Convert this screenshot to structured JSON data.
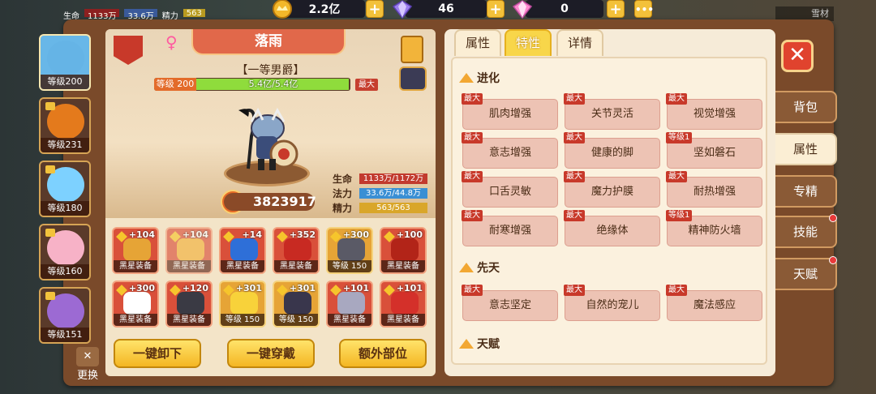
{
  "top": {
    "gold": "2.2亿",
    "gems": "46",
    "crystals": "0",
    "stats_hp_label": "生命",
    "stats_hp_value": "1133万",
    "stats_atk_value": "33.6万",
    "stats_energy_label": "精力",
    "stats_energy_value": "563",
    "right_label": "雪材"
  },
  "heroes": [
    {
      "level": "等级200",
      "color": "#65b4e6",
      "selected": true
    },
    {
      "level": "等级231",
      "color": "#e47a1c",
      "selected": false
    },
    {
      "level": "等级180",
      "color": "#7dd1ff",
      "selected": false
    },
    {
      "level": "等级160",
      "color": "#f7b2c7",
      "selected": false
    },
    {
      "level": "等级151",
      "color": "#9c6ad3",
      "selected": false
    }
  ],
  "hero": {
    "name": "落雨",
    "title": "【一等男爵】",
    "level_label": "等级 200",
    "exp_text": "5.4亿/5.4亿",
    "exp_fraction": 1.0,
    "max_badge": "最大",
    "power": "3823917",
    "hp_label": "生命",
    "hp_value": "1133万/1172万",
    "mp_label": "法力",
    "mp_value": "33.6万/44.8万",
    "en_label": "精力",
    "en_value": "563/563"
  },
  "equipment": [
    {
      "plus": "+104",
      "caption": "黑星装备",
      "style": "red",
      "art": "#e6a436"
    },
    {
      "plus": "+104",
      "caption": "黑星装备",
      "style": "red",
      "art": "#f2b13a",
      "dim": true
    },
    {
      "plus": "+14",
      "caption": "黑星装备",
      "style": "red",
      "art": "#2e6fd8"
    },
    {
      "plus": "+352",
      "caption": "黑星装备",
      "style": "red",
      "art": "#c82a22"
    },
    {
      "plus": "+300",
      "caption": "等级 150",
      "style": "gold",
      "art": "#5a5a66"
    },
    {
      "plus": "+100",
      "caption": "黑星装备",
      "style": "red",
      "art": "#b22418"
    },
    {
      "plus": "+300",
      "caption": "黑星装备",
      "style": "red",
      "art": "#ffffff"
    },
    {
      "plus": "+120",
      "caption": "黑星装备",
      "style": "red",
      "art": "#3a3a44"
    },
    {
      "plus": "+301",
      "caption": "等级 150",
      "style": "gold",
      "art": "#f8d23a"
    },
    {
      "plus": "+301",
      "caption": "等级 150",
      "style": "gold",
      "art": "#39364c"
    },
    {
      "plus": "+101",
      "caption": "黑星装备",
      "style": "red",
      "art": "#a8a8c0"
    },
    {
      "plus": "+101",
      "caption": "黑星装备",
      "style": "red",
      "art": "#d4302a"
    }
  ],
  "buttons": {
    "unequip": "一键卸下",
    "equip": "一键穿戴",
    "extra": "额外部位"
  },
  "swap_label": "更换",
  "tabs": {
    "attr": "属性",
    "trait": "特性",
    "detail": "详情"
  },
  "sections": {
    "evolve": "进化",
    "innate": "先天",
    "talent": "天赋"
  },
  "evolve_traits": [
    {
      "tag": "最大",
      "label": "肌肉增强"
    },
    {
      "tag": "最大",
      "label": "关节灵活"
    },
    {
      "tag": "最大",
      "label": "视觉增强"
    },
    {
      "tag": "最大",
      "label": "意志增强"
    },
    {
      "tag": "最大",
      "label": "健康的脚"
    },
    {
      "tag": "等级1",
      "label": "坚如磐石"
    },
    {
      "tag": "最大",
      "label": "口舌灵敏"
    },
    {
      "tag": "最大",
      "label": "魔力护膜"
    },
    {
      "tag": "最大",
      "label": "耐热增强"
    },
    {
      "tag": "最大",
      "label": "耐寒增强"
    },
    {
      "tag": "最大",
      "label": "绝缘体"
    },
    {
      "tag": "等级1",
      "label": "精神防火墙"
    }
  ],
  "innate_traits": [
    {
      "tag": "最大",
      "label": "意志坚定"
    },
    {
      "tag": "最大",
      "label": "自然的宠儿"
    },
    {
      "tag": "最大",
      "label": "魔法感应"
    }
  ],
  "side_tabs": [
    {
      "label": "背包",
      "active": false,
      "dot": false
    },
    {
      "label": "属性",
      "active": true,
      "dot": false
    },
    {
      "label": "专精",
      "active": false,
      "dot": false
    },
    {
      "label": "技能",
      "active": false,
      "dot": true
    },
    {
      "label": "天赋",
      "active": false,
      "dot": true
    }
  ],
  "colors": {
    "accent": "#f8d64a",
    "panel": "#f6ebd8",
    "trait": "#edc3b4",
    "tag": "#c8392a"
  }
}
